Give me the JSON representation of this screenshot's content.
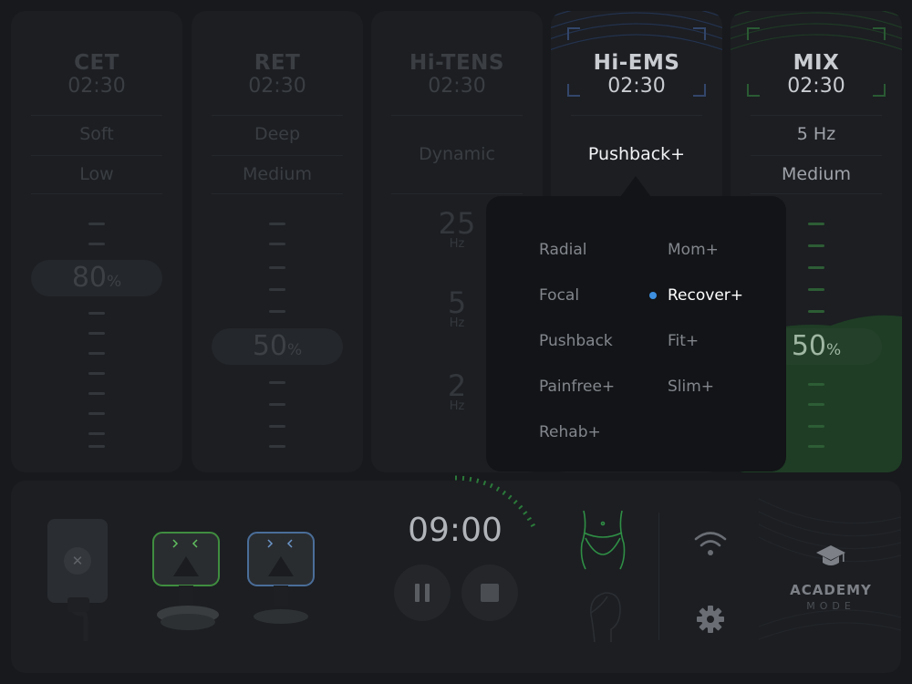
{
  "programs": [
    {
      "name": "CET",
      "time": "02:30",
      "options": [
        "Soft",
        "Low"
      ],
      "intensity": {
        "value": "80",
        "unit": "%"
      }
    },
    {
      "name": "RET",
      "time": "02:30",
      "options": [
        "Deep",
        "Medium"
      ],
      "intensity": {
        "value": "50",
        "unit": "%"
      }
    },
    {
      "name": "Hi-TENS",
      "time": "02:30",
      "options": [
        "Dynamic"
      ],
      "frequencies": [
        {
          "value": "25",
          "unit": "Hz"
        },
        {
          "value": "5",
          "unit": "Hz"
        },
        {
          "value": "2",
          "unit": "Hz"
        }
      ]
    },
    {
      "name": "Hi-EMS",
      "time": "02:30",
      "selected_mode": "Pushback+",
      "accent": "#3a5a9a"
    },
    {
      "name": "MIX",
      "time": "02:30",
      "options": [
        "5 Hz",
        "Medium"
      ],
      "intensity": {
        "value": "50",
        "unit": "%"
      },
      "accent": "#2e7d3a"
    }
  ],
  "mode_popup": {
    "left_column": [
      "Radial",
      "Focal",
      "Pushback",
      "Painfree+",
      "Rehab+"
    ],
    "right_column": [
      "Mom+",
      "Recover+",
      "Fit+",
      "Slim+"
    ],
    "selected": "Recover+",
    "selected_color": "#3d8fe0"
  },
  "bottom": {
    "timer": "09:00",
    "timer_progress": 0.18,
    "applicators": [
      {
        "name": "applicator-1",
        "glow": "#4fbf4f"
      },
      {
        "name": "applicator-2",
        "glow": "#5a8fd0"
      }
    ],
    "academy": {
      "line1": "ACADEMY",
      "line2": "MODE"
    },
    "icons": [
      "pad-disconnected-icon",
      "pause-icon",
      "stop-icon",
      "body-zone-icon",
      "face-zone-icon",
      "wifi-icon",
      "gear-icon",
      "graduation-cap-icon"
    ]
  }
}
